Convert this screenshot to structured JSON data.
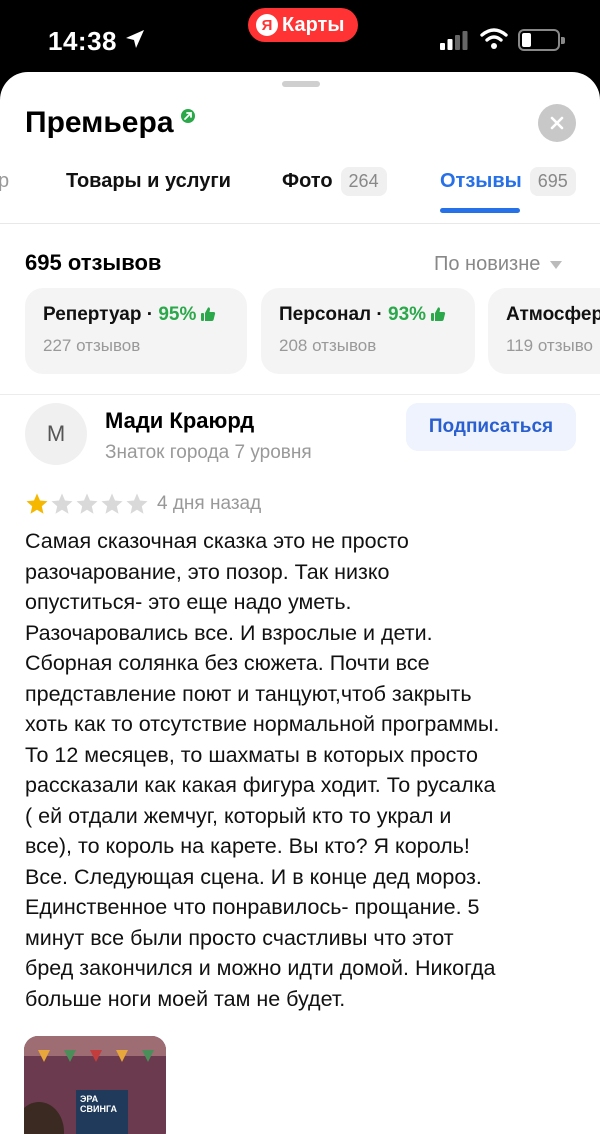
{
  "status_bar": {
    "time": "14:38",
    "app_badge": "Карты",
    "app_badge_logo": "Я"
  },
  "header": {
    "title": "Премьера",
    "close_icon": "close-icon"
  },
  "tabs": [
    {
      "label": "р",
      "count": ""
    },
    {
      "label": "Товары и услуги",
      "count": ""
    },
    {
      "label": "Фото",
      "count": "264"
    },
    {
      "label": "Отзывы",
      "count": "695",
      "active": true
    }
  ],
  "reviews": {
    "total": "695 отзывов",
    "sort": "По новизне"
  },
  "categories": [
    {
      "name": "Репертуар",
      "sep": " · ",
      "pct": "95%",
      "sub": "227 отзывов"
    },
    {
      "name": "Персонал",
      "sep": " · ",
      "pct": "93%",
      "sub": "208 отзывов"
    },
    {
      "name": "Атмосфер",
      "sep": "",
      "pct": "",
      "sub": "119 отзыво"
    }
  ],
  "review": {
    "avatar_letter": "М",
    "author": "Мади Краюрд",
    "author_level": "Знаток города 7 уровня",
    "subscribe": "Подписаться",
    "rating": 1,
    "rating_max": 5,
    "date": "4 дня назад",
    "lines": [
      "Самая сказочная сказка это не просто",
      "разочарование, это позор. Так низко",
      "опуститься- это еще надо уметь.",
      "Разочаровались все. И взрослые и дети.",
      "Сборная солянка без сюжета. Почти все",
      "представление поют и танцуют,чтоб закрыть",
      "хоть как то отсутствие нормальной программы.",
      "То 12 месяцев, то шахматы в которых просто",
      "рассказали как какая фигура ходит. То русалка",
      "( ей отдали жемчуг, который кто то украл и",
      "все), то король на карете. Вы кто? Я король!",
      "Все. Следующая сцена. И в конце дед мороз.",
      "Единственное что понравилось- прощание. 5",
      "минут все были просто счастливы что этот",
      "бред закончился и можно идти домой. Никогда",
      "больше ноги моей там не будет."
    ],
    "photo_poster_text": "ЭРА СВИНГА"
  },
  "colors": {
    "accent": "#2670e8",
    "positive": "#2aa84a",
    "star_on": "#f5b700",
    "star_off": "#d9d9d9",
    "badge_red": "#ff3333"
  }
}
